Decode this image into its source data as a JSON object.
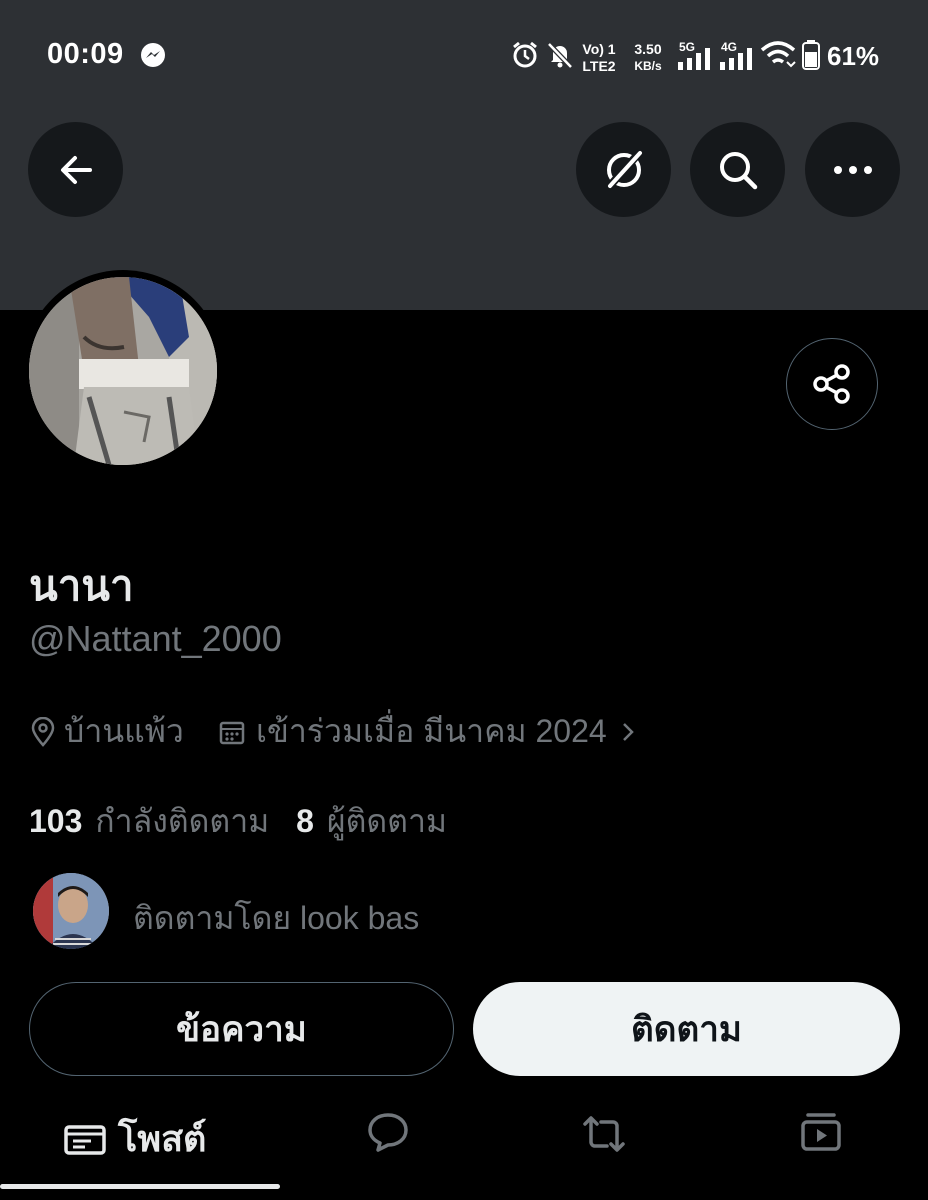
{
  "status_bar": {
    "time": "00:09",
    "volte": "Vo) 1",
    "lte": "LTE2",
    "speed_value": "3.50",
    "speed_unit": "KB/s",
    "net1": "5G",
    "net2": "4G",
    "battery": "61%"
  },
  "profile": {
    "display_name": "นานา",
    "handle": "@Nattant_2000",
    "location": "บ้านแพ้ว",
    "joined": "เข้าร่วมเมื่อ มีนาคม 2024"
  },
  "stats": {
    "following_count": "103",
    "following_label": "กำลังติดตาม",
    "followers_count": "8",
    "followers_label": "ผู้ติดตาม"
  },
  "followed_by": "ติดตามโดย look bas",
  "actions": {
    "message_label": "ข้อความ",
    "follow_label": "ติดตาม"
  },
  "tabs": {
    "posts_label": "โพสต์"
  },
  "colors": {
    "header_bg": "#2d3034",
    "background": "#000000",
    "secondary_text": "#71767b",
    "primary_text": "#e7e9ea",
    "follow_button": "#eff3f4"
  }
}
